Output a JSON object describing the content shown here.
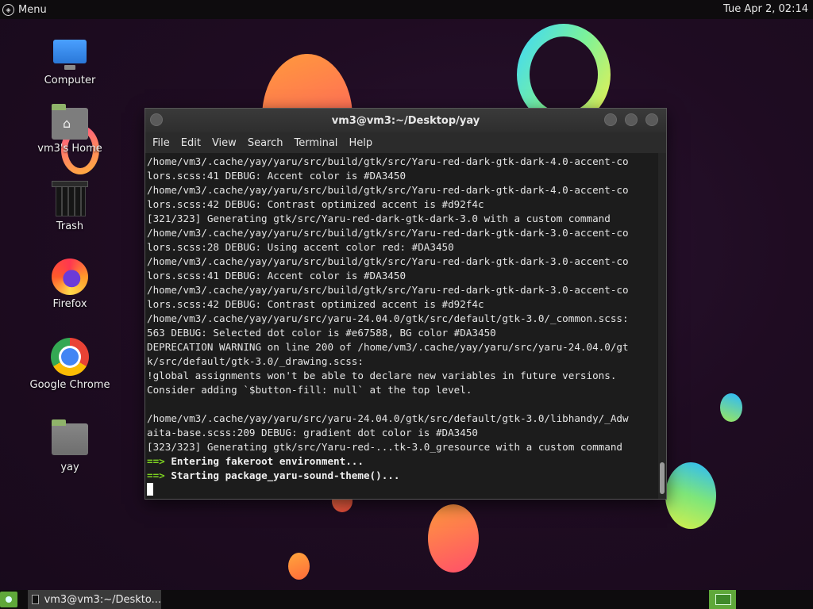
{
  "top_panel": {
    "menu_label": "Menu",
    "clock": "Tue Apr  2, 02:14"
  },
  "desktop_icons": [
    {
      "label": "Computer",
      "icon": "computer-icon"
    },
    {
      "label": "vm3's Home",
      "icon": "home-folder-icon"
    },
    {
      "label": "Trash",
      "icon": "trash-icon"
    },
    {
      "label": "Firefox",
      "icon": "firefox-icon"
    },
    {
      "label": "Google Chrome",
      "icon": "chrome-icon"
    },
    {
      "label": "yay",
      "icon": "folder-icon"
    }
  ],
  "terminal": {
    "title": "vm3@vm3:~/Desktop/yay",
    "menu": [
      "File",
      "Edit",
      "View",
      "Search",
      "Terminal",
      "Help"
    ],
    "lines": [
      "/home/vm3/.cache/yay/yaru/src/build/gtk/src/Yaru-red-dark-gtk-dark-4.0-accent-co",
      "lors.scss:41 DEBUG: Accent color is #DA3450",
      "/home/vm3/.cache/yay/yaru/src/build/gtk/src/Yaru-red-dark-gtk-dark-4.0-accent-co",
      "lors.scss:42 DEBUG: Contrast optimized accent is #d92f4c",
      "[321/323] Generating gtk/src/Yaru-red-dark-gtk-dark-3.0 with a custom command",
      "/home/vm3/.cache/yay/yaru/src/build/gtk/src/Yaru-red-dark-gtk-dark-3.0-accent-co",
      "lors.scss:28 DEBUG: Using accent color red: #DA3450",
      "/home/vm3/.cache/yay/yaru/src/build/gtk/src/Yaru-red-dark-gtk-dark-3.0-accent-co",
      "lors.scss:41 DEBUG: Accent color is #DA3450",
      "/home/vm3/.cache/yay/yaru/src/build/gtk/src/Yaru-red-dark-gtk-dark-3.0-accent-co",
      "lors.scss:42 DEBUG: Contrast optimized accent is #d92f4c",
      "/home/vm3/.cache/yay/yaru/src/yaru-24.04.0/gtk/src/default/gtk-3.0/_common.scss:",
      "563 DEBUG: Selected dot color is #e67588, BG color #DA3450",
      "DEPRECATION WARNING on line 200 of /home/vm3/.cache/yay/yaru/src/yaru-24.04.0/gt",
      "k/src/default/gtk-3.0/_drawing.scss:",
      "!global assignments won't be able to declare new variables in future versions.",
      "Consider adding `$button-fill: null` at the top level.",
      "",
      "/home/vm3/.cache/yay/yaru/src/yaru-24.04.0/gtk/src/default/gtk-3.0/libhandy/_Adw",
      "aita-base.scss:209 DEBUG: gradient dot color is #DA3450",
      "[323/323] Generating gtk/src/Yaru-red-...tk-3.0_gresource with a custom command"
    ],
    "arrow": "==>",
    "step1": "Entering fakeroot environment...",
    "step2": "Starting package_yaru-sound-theme()..."
  },
  "bottom_panel": {
    "task_label": "vm3@vm3:~/Deskto..."
  },
  "colors": {
    "accent_green": "#5fa83a",
    "prompt_green": "#7ed321"
  }
}
